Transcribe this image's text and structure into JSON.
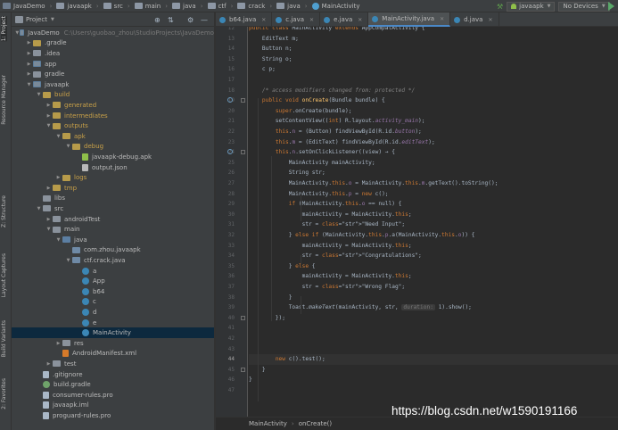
{
  "breadcrumb": [
    "JavaDemo",
    "javaapk",
    "src",
    "main",
    "java",
    "ctf",
    "crack",
    "java",
    "MainActivity"
  ],
  "toolbar": {
    "run_config": "javaapk",
    "device": "No Devices"
  },
  "left_stripe": [
    "1: Project",
    "Resource Manager",
    "Z: Structure",
    "Layout Captures",
    "Build Variants",
    "2: Favorites"
  ],
  "project": {
    "header": "Project",
    "tree": [
      {
        "depth": 0,
        "arrow": "▼",
        "icon": "module",
        "name": "JavaDemo",
        "sub": "C:\\Users\\guobao_zhou\\StudioProjects\\JavaDemo"
      },
      {
        "depth": 1,
        "arrow": "▶",
        "icon": "folder-y",
        "name": ".gradle"
      },
      {
        "depth": 1,
        "arrow": "▶",
        "icon": "folder",
        "name": ".idea"
      },
      {
        "depth": 1,
        "arrow": "▶",
        "icon": "module",
        "name": "app"
      },
      {
        "depth": 1,
        "arrow": "▶",
        "icon": "folder",
        "name": "gradle"
      },
      {
        "depth": 1,
        "arrow": "▼",
        "icon": "module",
        "name": "javaapk"
      },
      {
        "depth": 2,
        "arrow": "▼",
        "icon": "folder-y",
        "name": "build"
      },
      {
        "depth": 3,
        "arrow": "▶",
        "icon": "folder-y",
        "name": "generated"
      },
      {
        "depth": 3,
        "arrow": "▶",
        "icon": "folder-y",
        "name": "intermediates"
      },
      {
        "depth": 3,
        "arrow": "▼",
        "icon": "folder-y",
        "name": "outputs"
      },
      {
        "depth": 4,
        "arrow": "▼",
        "icon": "folder-y",
        "name": "apk"
      },
      {
        "depth": 5,
        "arrow": "▼",
        "icon": "folder-y",
        "name": "debug"
      },
      {
        "depth": 6,
        "arrow": "",
        "icon": "apk",
        "name": "javaapk-debug.apk"
      },
      {
        "depth": 6,
        "arrow": "",
        "icon": "json",
        "name": "output.json"
      },
      {
        "depth": 4,
        "arrow": "▶",
        "icon": "folder-y",
        "name": "logs"
      },
      {
        "depth": 3,
        "arrow": "▶",
        "icon": "folder-y",
        "name": "tmp"
      },
      {
        "depth": 2,
        "arrow": "",
        "icon": "folder",
        "name": "libs"
      },
      {
        "depth": 2,
        "arrow": "▼",
        "icon": "folder",
        "name": "src"
      },
      {
        "depth": 3,
        "arrow": "▶",
        "icon": "folder",
        "name": "androidTest"
      },
      {
        "depth": 3,
        "arrow": "▼",
        "icon": "folder",
        "name": "main"
      },
      {
        "depth": 4,
        "arrow": "▼",
        "icon": "folder-b",
        "name": "java"
      },
      {
        "depth": 5,
        "arrow": "",
        "icon": "folder-s",
        "name": "com.zhou.javaapk"
      },
      {
        "depth": 5,
        "arrow": "▼",
        "icon": "folder-s",
        "name": "ctf.crack.java"
      },
      {
        "depth": 6,
        "arrow": "",
        "icon": "cls",
        "name": "a"
      },
      {
        "depth": 6,
        "arrow": "",
        "icon": "cls",
        "name": "App"
      },
      {
        "depth": 6,
        "arrow": "",
        "icon": "cls",
        "name": "b64"
      },
      {
        "depth": 6,
        "arrow": "",
        "icon": "cls",
        "name": "c"
      },
      {
        "depth": 6,
        "arrow": "",
        "icon": "cls",
        "name": "d"
      },
      {
        "depth": 6,
        "arrow": "",
        "icon": "cls",
        "name": "e"
      },
      {
        "depth": 6,
        "arrow": "",
        "icon": "cls",
        "name": "MainActivity",
        "selected": true
      },
      {
        "depth": 4,
        "arrow": "▶",
        "icon": "folder",
        "name": "res"
      },
      {
        "depth": 4,
        "arrow": "",
        "icon": "xml",
        "name": "AndroidManifest.xml"
      },
      {
        "depth": 3,
        "arrow": "▶",
        "icon": "folder",
        "name": "test"
      },
      {
        "depth": 2,
        "arrow": "",
        "icon": "file",
        "name": ".gitignore"
      },
      {
        "depth": 2,
        "arrow": "",
        "icon": "gradle",
        "name": "build.gradle"
      },
      {
        "depth": 2,
        "arrow": "",
        "icon": "file",
        "name": "consumer-rules.pro"
      },
      {
        "depth": 2,
        "arrow": "",
        "icon": "file",
        "name": "javaapk.iml"
      },
      {
        "depth": 2,
        "arrow": "",
        "icon": "file",
        "name": "proguard-rules.pro"
      }
    ]
  },
  "editor": {
    "tabs": [
      {
        "name": "b64.java",
        "active": false
      },
      {
        "name": "c.java",
        "active": false
      },
      {
        "name": "e.java",
        "active": false
      },
      {
        "name": "MainActivity.java",
        "active": true
      },
      {
        "name": "d.java",
        "active": false
      }
    ],
    "line_numbers": [
      "12",
      "13",
      "14",
      "15",
      "16",
      "17",
      "18",
      "19",
      "20",
      "21",
      "22",
      "23",
      "24",
      "25",
      "26",
      "27",
      "28",
      "29",
      "30",
      "31",
      "32",
      "33",
      "34",
      "35",
      "36",
      "37",
      "38",
      "39",
      "40",
      "41",
      "42",
      "43",
      "44",
      "45",
      "46",
      "47"
    ],
    "current_line": 44,
    "code_lines": [
      "public class MainActivity extends AppCompatActivity {",
      "    EditText m;",
      "    Button n;",
      "    String o;",
      "    c p;",
      "",
      "    /* access modifiers changed from: protected */",
      "    public void onCreate(Bundle bundle) {",
      "        super.onCreate(bundle);",
      "        setContentView((int) R.layout.activity_main);",
      "        this.n = (Button) findViewById(R.id.button);",
      "        this.m = (EditText) findViewById(R.id.editText);",
      "        this.n.setOnClickListener((view) → {",
      "            MainActivity mainActivity;",
      "            String str;",
      "            MainActivity.this.o = MainActivity.this.m.getText().toString();",
      "            MainActivity.this.p = new c();",
      "            if (MainActivity.this.o == null) {",
      "                mainActivity = MainActivity.this;",
      "                str = \"Need Input\";",
      "            } else if (MainActivity.this.p.a(MainActivity.this.o)) {",
      "                mainActivity = MainActivity.this;",
      "                str = \"Congratulations\";",
      "            } else {",
      "                mainActivity = MainActivity.this;",
      "                str = \"Wrong Flag\";",
      "            }",
      "            Toast.makeText(mainActivity, str, duration: 1).show();",
      "        });",
      "",
      "",
      "",
      "        new c().test();",
      "    }",
      "}",
      ""
    ]
  },
  "status": {
    "class": "MainActivity",
    "method": "onCreate()"
  },
  "watermark": "https://blog.csdn.net/w1590191166"
}
